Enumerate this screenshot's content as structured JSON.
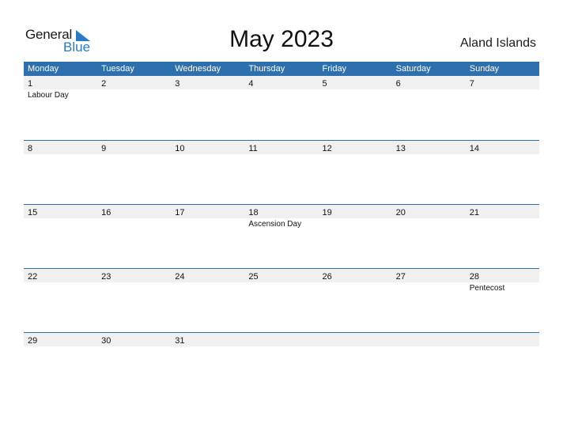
{
  "logo": {
    "word1": "General",
    "word2": "Blue"
  },
  "title": "May 2023",
  "country": "Aland Islands",
  "colors": {
    "header_bg": "#2e6fae",
    "logo_blue": "#2a7bc4",
    "date_strip": "#f0f0f0"
  },
  "weekdays": [
    "Monday",
    "Tuesday",
    "Wednesday",
    "Thursday",
    "Friday",
    "Saturday",
    "Sunday"
  ],
  "weeks": [
    {
      "days": [
        "1",
        "2",
        "3",
        "4",
        "5",
        "6",
        "7"
      ],
      "holidays": [
        "Labour Day",
        "",
        "",
        "",
        "",
        "",
        ""
      ]
    },
    {
      "days": [
        "8",
        "9",
        "10",
        "11",
        "12",
        "13",
        "14"
      ],
      "holidays": [
        "",
        "",
        "",
        "",
        "",
        "",
        ""
      ]
    },
    {
      "days": [
        "15",
        "16",
        "17",
        "18",
        "19",
        "20",
        "21"
      ],
      "holidays": [
        "",
        "",
        "",
        "Ascension Day",
        "",
        "",
        ""
      ]
    },
    {
      "days": [
        "22",
        "23",
        "24",
        "25",
        "26",
        "27",
        "28"
      ],
      "holidays": [
        "",
        "",
        "",
        "",
        "",
        "",
        "Pentecost"
      ]
    },
    {
      "days": [
        "29",
        "30",
        "31",
        "",
        "",
        "",
        ""
      ],
      "holidays": [
        "",
        "",
        "",
        "",
        "",
        "",
        ""
      ]
    }
  ]
}
